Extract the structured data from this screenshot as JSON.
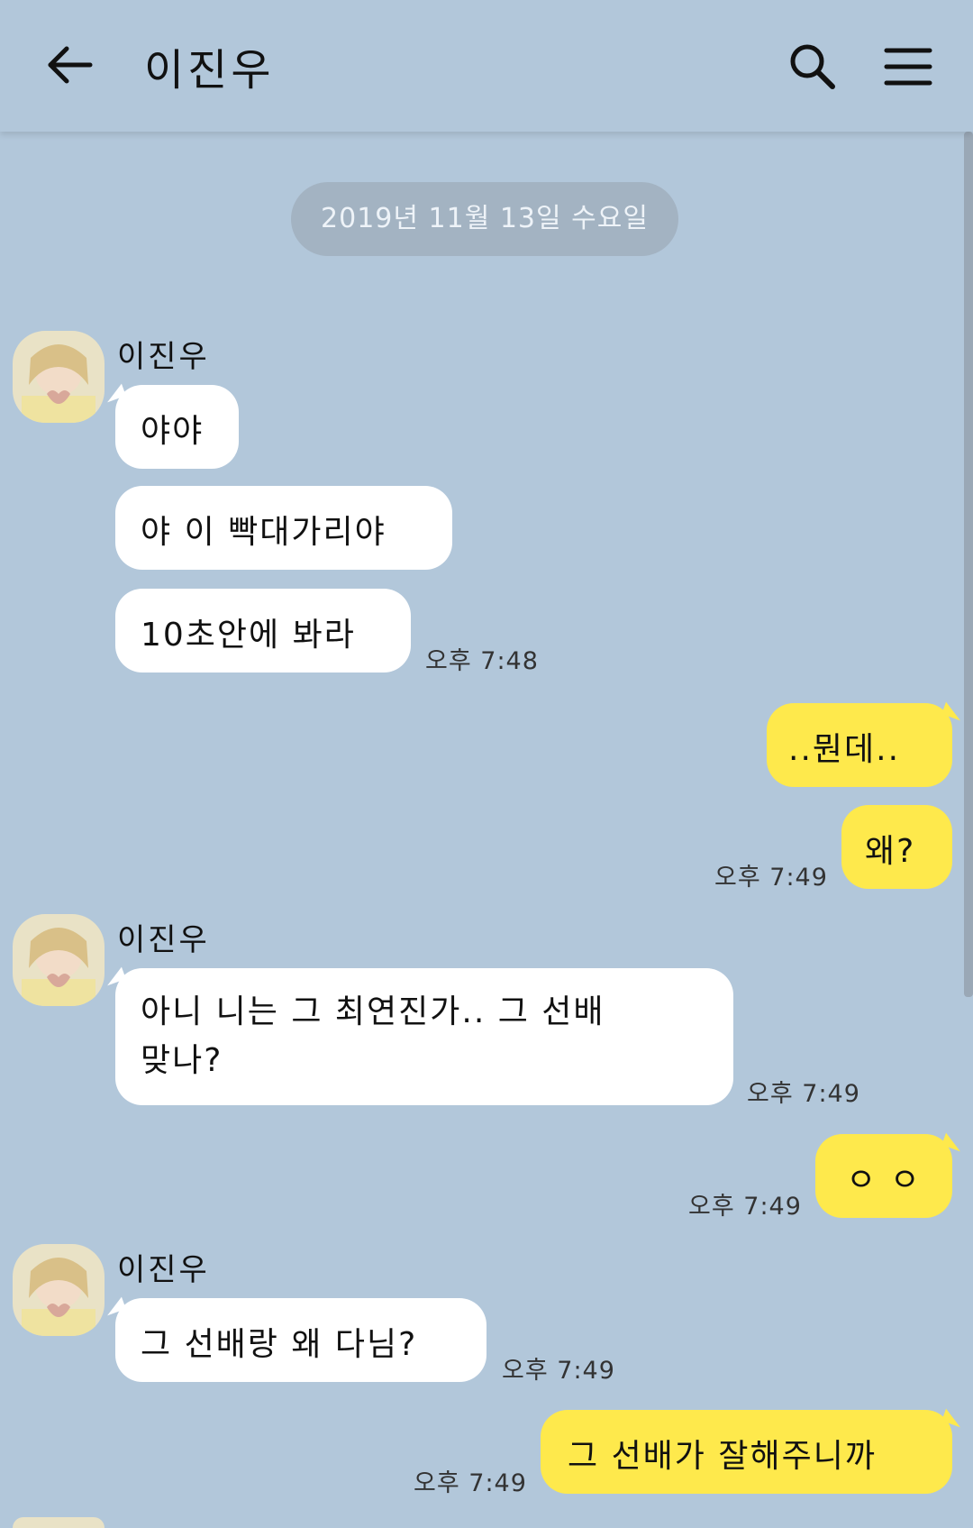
{
  "header": {
    "title": "이진우",
    "back_icon": "arrow-left-icon",
    "search_icon": "search-icon",
    "menu_icon": "hamburger-menu-icon"
  },
  "date_divider": "2019년 11월 13일 수요일",
  "colors": {
    "background": "#b2c7da",
    "incoming_bubble": "#ffffff",
    "outgoing_bubble": "#fee94c",
    "date_pill": "#a3b3c2"
  },
  "messages": {
    "g1": {
      "sender": "이진우",
      "m1": "야야",
      "m2": "야 이 빡대가리야",
      "m3": "10초안에 봐라",
      "time": "오후 7:48"
    },
    "o1": {
      "m1": "..뭔데..",
      "m2": "왜?",
      "time": "오후 7:49"
    },
    "g2": {
      "sender": "이진우",
      "line1": "아니 니는 그 최연진가.. 그 선배",
      "line2": "맞나?",
      "time": "오후 7:49"
    },
    "o2": {
      "m1": "ㅇ ㅇ",
      "time": "오후 7:49"
    },
    "g3": {
      "sender": "이진우",
      "m1": "그 선배랑 왜 다님?",
      "time": "오후 7:49"
    },
    "o3": {
      "m1": "그 선배가 잘해주니까",
      "time": "오후 7:49"
    }
  }
}
